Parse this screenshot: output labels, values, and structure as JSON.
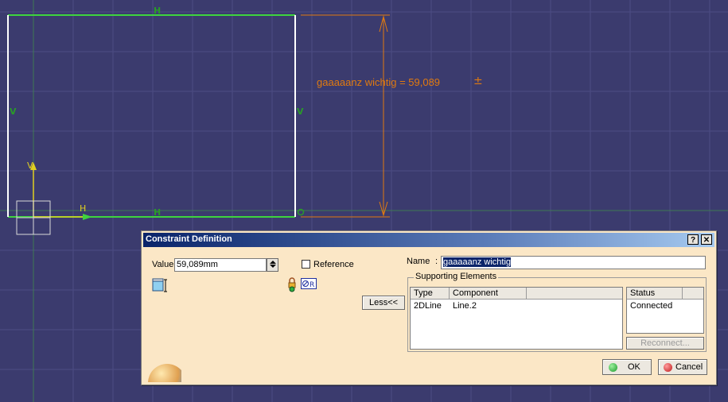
{
  "sketch": {
    "labels": {
      "h_top": "H",
      "h_bottom": "H",
      "v_left": "V",
      "v_right": "V",
      "axis_h": "H",
      "axis_v": "V",
      "origin": "O"
    },
    "dimension_text": "gaaaaanz wichtig = 59,089",
    "tolerance_symbol": "±",
    "colors": {
      "background": "#3b3b6e",
      "constraint": "#2a9a2a",
      "dimension": "#e07a10",
      "line": "#ffffff",
      "axis": "#e0d020"
    }
  },
  "dialog": {
    "title": "Constraint Definition",
    "help_label": "?",
    "close_label": "✕",
    "value_label": "Value",
    "value": "59,089mm",
    "reference_label": "Reference",
    "reference_checked": false,
    "less_label": "Less<<",
    "name_label": "Name",
    "name_value": "gaaaaanz wichtig",
    "supporting_title": "Supporting Elements",
    "columns": [
      "Type",
      "Component"
    ],
    "rows": [
      {
        "type": "2DLine",
        "component": "Line.2"
      }
    ],
    "status_header": "Status",
    "status_value": "Connected",
    "reconnect_label": "Reconnect...",
    "ok_label": "OK",
    "cancel_label": "Cancel"
  }
}
